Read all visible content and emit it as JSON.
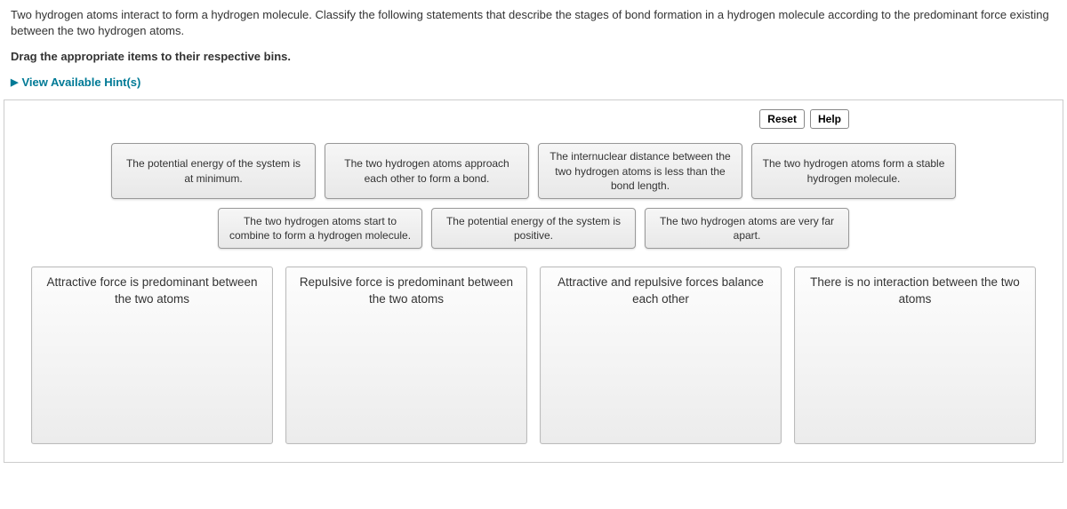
{
  "question": {
    "prompt": "Two hydrogen atoms interact to form a hydrogen molecule. Classify the following statements that describe the stages of bond formation in a hydrogen molecule according to the predominant force existing between the two hydrogen atoms.",
    "instruction": "Drag the appropriate items to their respective bins.",
    "hint_toggle": "View Available Hint(s)"
  },
  "toolbar": {
    "reset": "Reset",
    "help": "Help"
  },
  "items": {
    "row1": [
      "The potential energy of the system is at minimum.",
      "The two hydrogen atoms approach each other to form a bond.",
      "The internuclear distance between the two hydrogen atoms is less than the bond length.",
      "The two hydrogen atoms form a stable hydrogen molecule."
    ],
    "row2": [
      "The two hydrogen atoms start to combine to form a hydrogen molecule.",
      "The potential energy of the system is positive.",
      "The two hydrogen atoms are very far apart."
    ]
  },
  "bins": [
    "Attractive force is predominant between the two atoms",
    "Repulsive force is predominant between the two atoms",
    "Attractive and repulsive forces balance each other",
    "There is no interaction between the two atoms"
  ]
}
